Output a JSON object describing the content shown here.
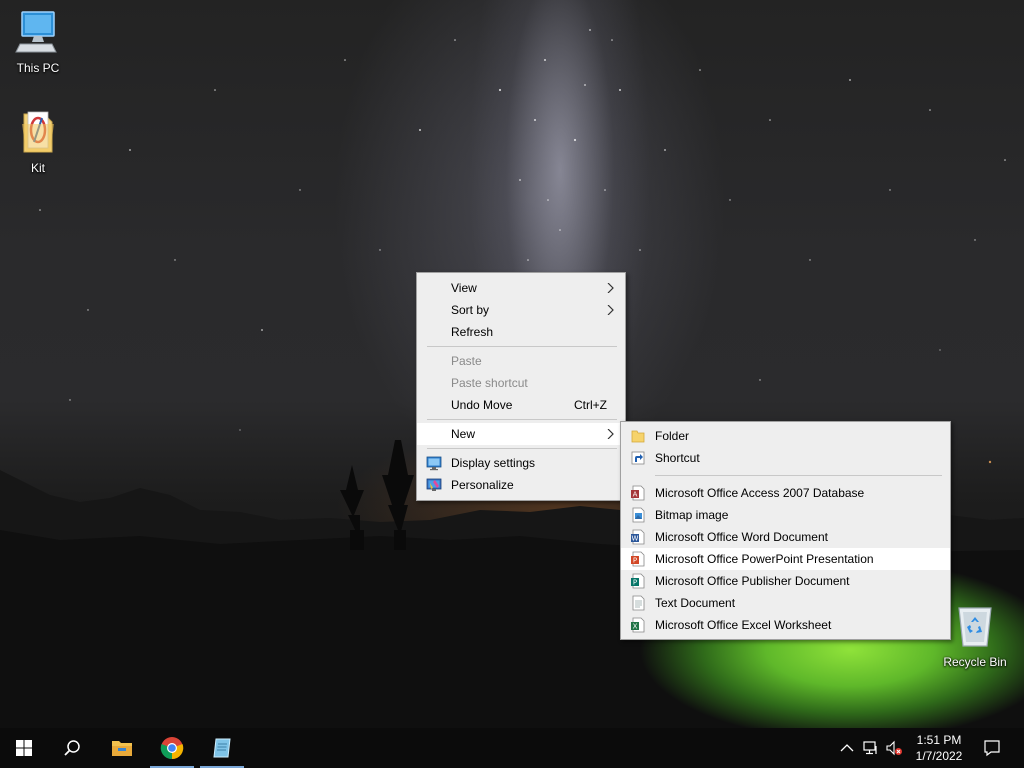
{
  "desktop": {
    "icons": [
      {
        "label": "This PC",
        "icon": "this-pc-icon"
      },
      {
        "label": "Kit",
        "icon": "folder-kit-icon"
      },
      {
        "label": "Recycle Bin",
        "icon": "recycle-bin-icon"
      }
    ]
  },
  "context_menu": {
    "items": [
      {
        "label": "View",
        "submenu": true
      },
      {
        "label": "Sort by",
        "submenu": true
      },
      {
        "label": "Refresh"
      },
      {
        "label": "Paste",
        "disabled": true
      },
      {
        "label": "Paste shortcut",
        "disabled": true
      },
      {
        "label": "Undo Move",
        "accelerator": "Ctrl+Z"
      },
      {
        "label": "New",
        "submenu": true,
        "active": true
      },
      {
        "label": "Display settings",
        "icon": "display-settings-icon"
      },
      {
        "label": "Personalize",
        "icon": "personalize-icon"
      }
    ]
  },
  "new_submenu": {
    "items": [
      {
        "label": "Folder",
        "icon": "folder-icon"
      },
      {
        "label": "Shortcut",
        "icon": "shortcut-icon"
      },
      {
        "label": "Microsoft Office Access 2007 Database",
        "icon": "access-icon"
      },
      {
        "label": "Bitmap image",
        "icon": "bitmap-icon"
      },
      {
        "label": "Microsoft Office Word Document",
        "icon": "word-icon"
      },
      {
        "label": "Microsoft Office PowerPoint Presentation",
        "icon": "powerpoint-icon",
        "highlighted": true
      },
      {
        "label": "Microsoft Office Publisher Document",
        "icon": "publisher-icon"
      },
      {
        "label": "Text Document",
        "icon": "text-document-icon"
      },
      {
        "label": "Microsoft Office Excel Worksheet",
        "icon": "excel-icon"
      }
    ]
  },
  "taskbar": {
    "buttons": [
      "start-icon",
      "search-icon",
      "file-explorer-icon",
      "chrome-icon",
      "notepad-icon"
    ],
    "tray": [
      "chevron-up-icon",
      "network-icon",
      "volume-muted-icon",
      "action-center-icon"
    ],
    "clock": {
      "time": "1:51 PM",
      "date": "1/7/2022"
    }
  },
  "colors": {
    "menu_bg": "#eeeeee",
    "menu_highlight": "#ffffff",
    "taskbar_bg": "#0b0b0b",
    "running_underline": "#7aa7d8"
  }
}
